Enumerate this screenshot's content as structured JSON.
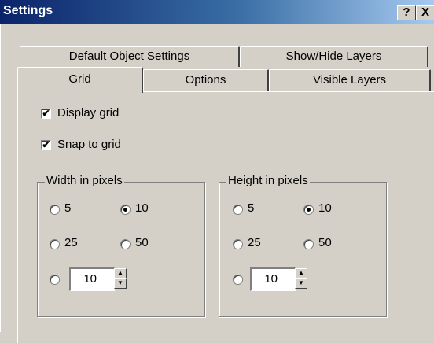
{
  "window": {
    "title": "Settings",
    "help_label": "?",
    "close_label": "X"
  },
  "tabs": {
    "row_back": [
      "Default Object Settings",
      "Show/Hide Layers"
    ],
    "row_front": [
      "Grid",
      "Options",
      "Visible Layers"
    ],
    "active": "Grid"
  },
  "grid": {
    "display_grid": {
      "label": "Display grid",
      "checked": true,
      "mark": "✔"
    },
    "snap_to_grid": {
      "label": "Snap to grid",
      "checked": true,
      "mark": "✔"
    },
    "width": {
      "legend": "Width in pixels",
      "options": [
        "5",
        "10",
        "25",
        "50"
      ],
      "selected": "10",
      "custom_value": "10"
    },
    "height": {
      "legend": "Height in pixels",
      "options": [
        "5",
        "10",
        "25",
        "50"
      ],
      "selected": "10",
      "custom_value": "10"
    }
  },
  "icons": {
    "spin_up": "▲",
    "spin_down": "▼"
  }
}
